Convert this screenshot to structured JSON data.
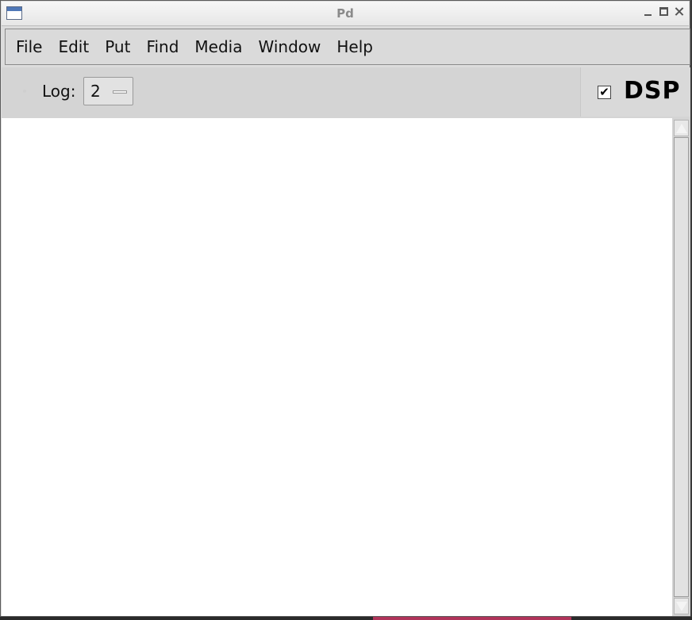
{
  "window": {
    "title": "Pd"
  },
  "menubar": {
    "items": [
      "File",
      "Edit",
      "Put",
      "Find",
      "Media",
      "Window",
      "Help"
    ]
  },
  "toolbar": {
    "log_label": "Log:",
    "log_value": "2",
    "dsp_checked": true,
    "dsp_check_glyph": "✔",
    "dsp_label": "DSP"
  },
  "icons": {
    "app": "window-icon",
    "minimize": "minimize-icon",
    "maximize": "maximize-icon",
    "close": "close-icon",
    "scroll_up": "arrow-up-icon",
    "scroll_down": "arrow-down-icon",
    "dropdown": "dropdown-indicator-icon"
  },
  "colors": {
    "chrome": "#dcdcdc",
    "console_bg": "#ffffff",
    "text": "#111111",
    "title_text": "#8a8a8a"
  }
}
